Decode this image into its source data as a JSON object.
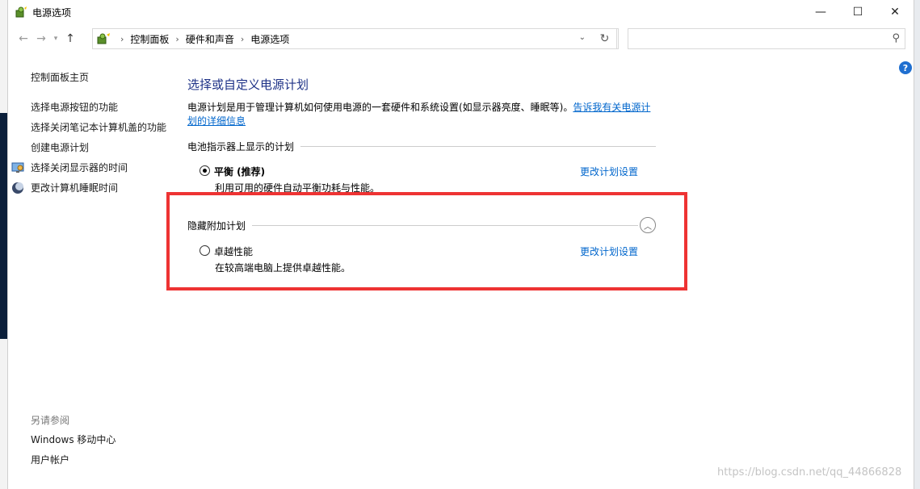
{
  "window": {
    "title": "电源选项",
    "controls": {
      "minimize": "—",
      "maximize": "☐",
      "close": "✕"
    }
  },
  "address": {
    "crumbs": [
      "控制面板",
      "硬件和声音",
      "电源选项"
    ],
    "search_placeholder": ""
  },
  "leftnav": {
    "home": "控制面板主页",
    "items": [
      "选择电源按钮的功能",
      "选择关闭笔记本计算机盖的功能",
      "创建电源计划",
      "选择关闭显示器的时间",
      "更改计算机睡眠时间"
    ],
    "see_also_title": "另请参阅",
    "see_also": [
      "Windows 移动中心",
      "用户帐户"
    ]
  },
  "main": {
    "title": "选择或自定义电源计划",
    "description": "电源计划是用于管理计算机如何使用电源的一套硬件和系统设置(如显示器亮度、睡眠等)。",
    "description_link": "告诉我有关电源计划的详细信息",
    "battery_group": {
      "title": "电池指示器上显示的计划",
      "plan_name": "平衡 (推荐)",
      "plan_desc": "利用可用的硬件自动平衡功耗与性能。",
      "plan_link": "更改计划设置",
      "selected": true
    },
    "hidden_group": {
      "title": "隐藏附加计划",
      "plan_name": "卓越性能",
      "plan_desc": "在较高端电脑上提供卓越性能。",
      "plan_link": "更改计划设置",
      "selected": false
    }
  },
  "watermark": "https://blog.csdn.net/qq_44866828",
  "colors": {
    "title_blue": "#1e3287",
    "link_blue": "#0066cc",
    "highlight_red": "#ee3333"
  }
}
